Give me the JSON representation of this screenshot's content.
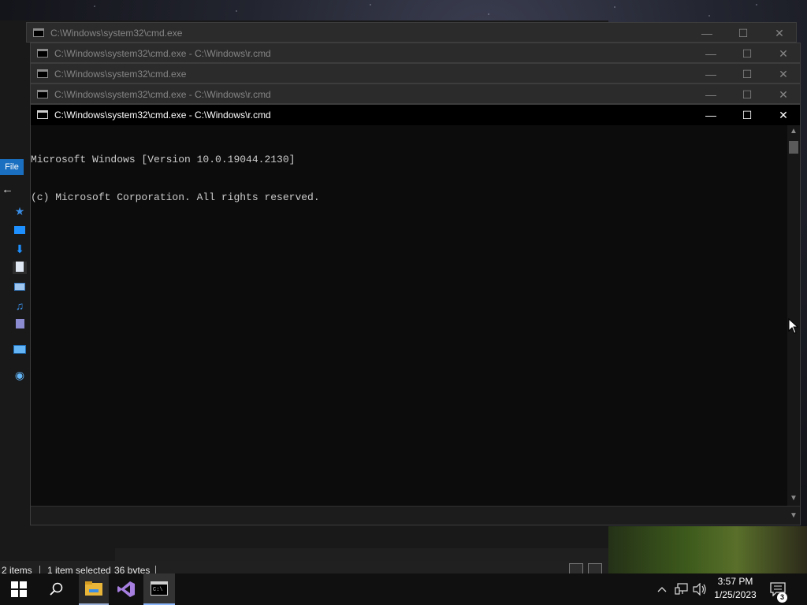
{
  "explorer": {
    "ribbon_file": "File",
    "status_items": "2 items",
    "status_selected": "1 item selected",
    "status_size": "36 bytes"
  },
  "cmd_windows": [
    {
      "title": "C:\\Windows\\system32\\cmd.exe"
    },
    {
      "title": "C:\\Windows\\system32\\cmd.exe - C:\\Windows\\r.cmd"
    },
    {
      "title": "C:\\Windows\\system32\\cmd.exe"
    },
    {
      "title": "C:\\Windows\\system32\\cmd.exe - C:\\Windows\\r.cmd"
    }
  ],
  "active_cmd": {
    "title": "C:\\Windows\\system32\\cmd.exe - C:\\Windows\\r.cmd",
    "lines": [
      "Microsoft Windows [Version 10.0.19044.2130]",
      "(c) Microsoft Corporation. All rights reserved."
    ]
  },
  "window_controls": {
    "minimize": "—",
    "maximize": "☐",
    "close": "✕"
  },
  "taskbar": {
    "apps": [
      {
        "name": "start",
        "icon": "windows-logo-icon"
      },
      {
        "name": "search",
        "icon": "search-icon"
      },
      {
        "name": "file-explorer",
        "icon": "folder-icon"
      },
      {
        "name": "visual-studio",
        "icon": "visual-studio-icon"
      },
      {
        "name": "command-prompt",
        "icon": "cmd-icon"
      }
    ],
    "time": "3:57 PM",
    "date": "1/25/2023",
    "notification_count": "3"
  },
  "colors": {
    "accent": "#1a6fc0",
    "console_bg": "#0c0c0c",
    "console_text": "#cccccc"
  }
}
